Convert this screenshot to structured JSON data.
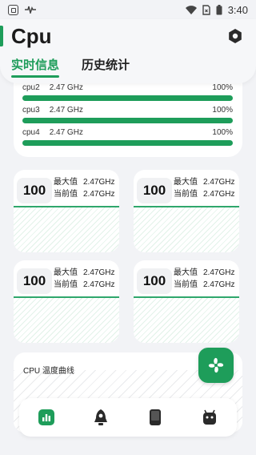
{
  "status_bar": {
    "time": "3:40"
  },
  "app": {
    "title": "Cpu"
  },
  "tabs": [
    {
      "label": "实时信息",
      "active": true
    },
    {
      "label": "历史统计",
      "active": false
    }
  ],
  "cpu_list": [
    {
      "name": "cpu2",
      "freq": "2.47 GHz",
      "percent": "100%"
    },
    {
      "name": "cpu3",
      "freq": "2.47 GHz",
      "percent": "100%"
    },
    {
      "name": "cpu4",
      "freq": "2.47 GHz",
      "percent": "100%"
    }
  ],
  "core_cards": [
    {
      "value": "100",
      "max_label": "最大值",
      "max": "2.47GHz",
      "cur_label": "当前值",
      "cur": "2.47GHz"
    },
    {
      "value": "100",
      "max_label": "最大值",
      "max": "2.47GHz",
      "cur_label": "当前值",
      "cur": "2.47GHz"
    },
    {
      "value": "100",
      "max_label": "最大值",
      "max": "2.47GHz",
      "cur_label": "当前值",
      "cur": "2.47GHz"
    },
    {
      "value": "100",
      "max_label": "最大值",
      "max": "2.47GHz",
      "cur_label": "当前值",
      "cur": "2.47GHz"
    }
  ],
  "temperature": {
    "title": "CPU 温度曲线"
  },
  "nav": [
    "chart-icon",
    "rocket-icon",
    "phone-icon",
    "android-icon"
  ],
  "colors": {
    "accent": "#1e9d5a",
    "background": "#f2f3f6"
  }
}
